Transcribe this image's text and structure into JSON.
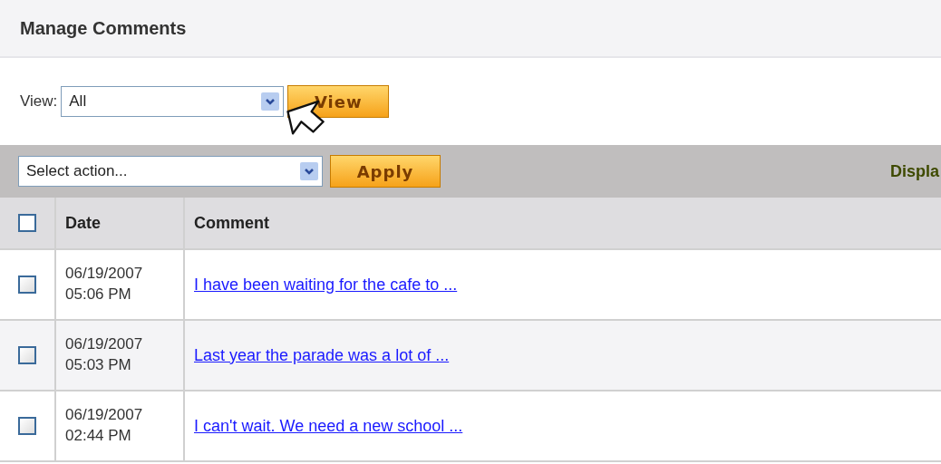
{
  "title": "Manage Comments",
  "view_filter": {
    "label": "View:",
    "value": "All",
    "button": "View"
  },
  "action_bar": {
    "action_select": "Select action...",
    "button": "Apply",
    "display_text": "Displa"
  },
  "table": {
    "header_checkbox": {
      "checked": false
    },
    "columns": [
      "Date",
      "Comment"
    ],
    "rows": [
      {
        "checked": false,
        "date": "06/19/2007",
        "time": "05:06 PM",
        "comment": "I have been waiting for the cafe to ..."
      },
      {
        "checked": false,
        "date": "06/19/2007",
        "time": "05:03 PM",
        "comment": "Last year the parade was a lot of ..."
      },
      {
        "checked": false,
        "date": "06/19/2007",
        "time": "02:44 PM",
        "comment": "I can't wait. We need a new school ..."
      }
    ]
  }
}
